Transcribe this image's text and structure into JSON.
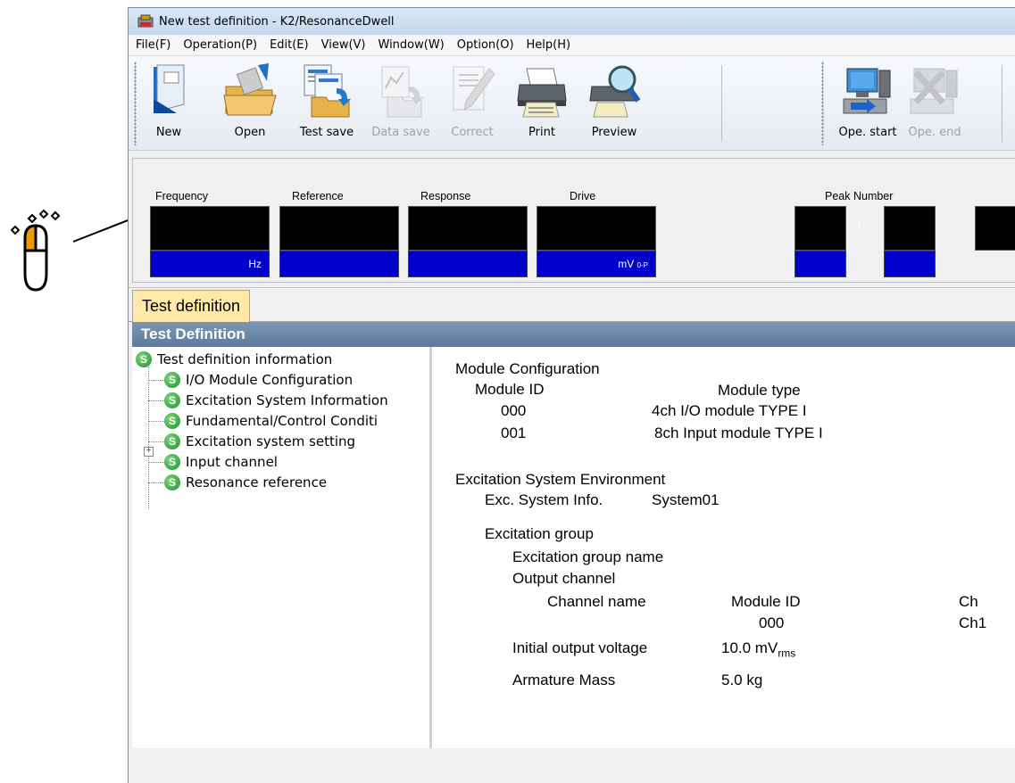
{
  "window": {
    "title": "New test definition - K2/ResonanceDwell"
  },
  "menu": [
    "File(F)",
    "Operation(P)",
    "Edit(E)",
    "View(V)",
    "Window(W)",
    "Option(O)",
    "Help(H)"
  ],
  "toolbar": {
    "new": "New",
    "open": "Open",
    "test_save": "Test save",
    "data_save": "Data save",
    "correct": "Correct",
    "print": "Print",
    "preview": "Preview",
    "ope_start": "Ope. start",
    "ope_end": "Ope. end"
  },
  "monitor": {
    "frequency_label": "Frequency",
    "frequency_unit": "Hz",
    "reference_label": "Reference",
    "response_label": "Response",
    "drive_label": "Drive",
    "drive_unit": "mV",
    "drive_unit_suffix": "0-P",
    "peak_label": "Peak Number",
    "peak_sep": "/"
  },
  "tabs": {
    "test_definition": "Test definition"
  },
  "panel": {
    "header": "Test Definition"
  },
  "tree": {
    "root": "Test definition information",
    "items": [
      "I/O Module Configuration",
      "Excitation System Information",
      "Fundamental/Control Conditi",
      "Excitation system setting",
      "Input channel",
      "Resonance reference"
    ]
  },
  "details": {
    "module_config": "Module Configuration",
    "module_id_hdr": "Module ID",
    "module_type_hdr": "Module type",
    "modules": [
      {
        "id": "000",
        "type": "4ch I/O module TYPE I"
      },
      {
        "id": "001",
        "type": "8ch Input module TYPE I"
      }
    ],
    "exc_env": "Excitation System Environment",
    "exc_info_label": "Exc. System Info.",
    "exc_info_value": "System01",
    "exc_group": "Excitation group",
    "exc_group_name": "Excitation group name",
    "output_channel": "Output channel",
    "channel_name_hdr": "Channel name",
    "module_id_hdr2": "Module ID",
    "ch_hdr": "Ch",
    "out_module_id": "000",
    "out_ch": "Ch1",
    "init_voltage_label": "Initial output voltage",
    "init_voltage_value": "10.0 mV",
    "init_voltage_sub": "rms",
    "armature_label": "Armature Mass",
    "armature_value": "5.0 kg"
  },
  "colors": {
    "accent_orange": "#f39800",
    "tab_yellow": "#ffe9a8",
    "panel_header": "#6a86a6",
    "unit_blue": "#0000cc"
  }
}
